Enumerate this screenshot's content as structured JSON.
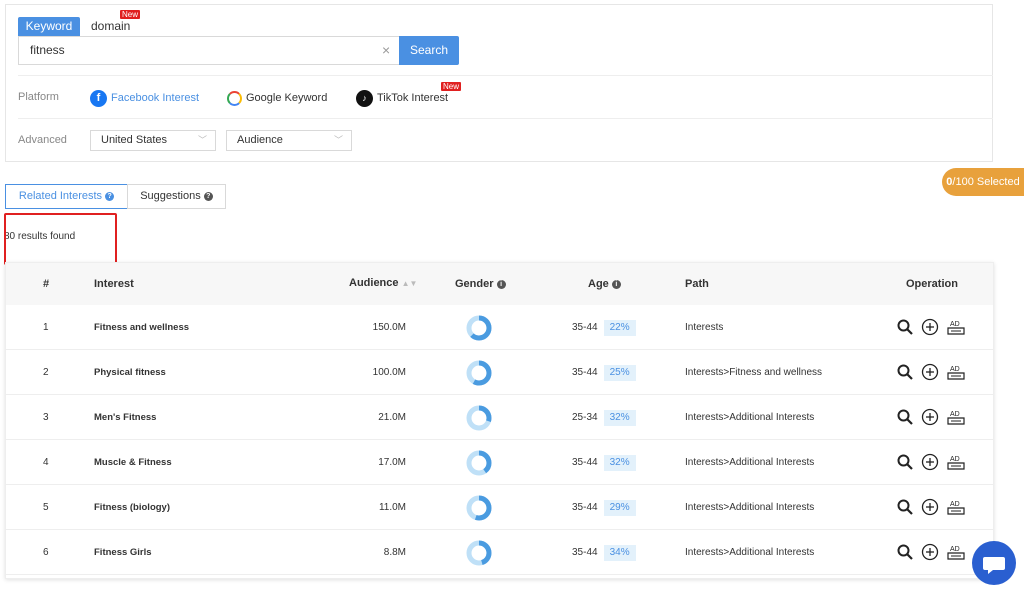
{
  "search": {
    "tab_keyword": "Keyword",
    "tab_domain": "domain",
    "new_label": "New",
    "query": "fitness",
    "search_label": "Search"
  },
  "platform": {
    "label": "Platform",
    "facebook": "Facebook Interest",
    "google": "Google Keyword",
    "tiktok": "TikTok Interest"
  },
  "advanced": {
    "label": "Advanced",
    "country": "United States",
    "audience": "Audience"
  },
  "selected": {
    "count": "0",
    "total": "/100 Selected"
  },
  "result_tabs": {
    "related": "Related Interests",
    "suggestions": "Suggestions"
  },
  "results_count": "80 results found",
  "table": {
    "headers": {
      "index": "#",
      "interest": "Interest",
      "audience": "Audience",
      "gender": "Gender",
      "age": "Age",
      "path": "Path",
      "operation": "Operation"
    },
    "rows": [
      {
        "index": "1",
        "interest": "Fitness and wellness",
        "audience": "150.0M",
        "age": "35-44",
        "pct": "22%",
        "path": "Interests",
        "female_share": 0.62
      },
      {
        "index": "2",
        "interest": "Physical fitness",
        "audience": "100.0M",
        "age": "35-44",
        "pct": "25%",
        "path": "Interests>Fitness and wellness",
        "female_share": 0.58
      },
      {
        "index": "3",
        "interest": "Men's Fitness",
        "audience": "21.0M",
        "age": "25-34",
        "pct": "32%",
        "path": "Interests>Additional Interests",
        "female_share": 0.3
      },
      {
        "index": "4",
        "interest": "Muscle & Fitness",
        "audience": "17.0M",
        "age": "35-44",
        "pct": "32%",
        "path": "Interests>Additional Interests",
        "female_share": 0.4
      },
      {
        "index": "5",
        "interest": "Fitness (biology)",
        "audience": "11.0M",
        "age": "35-44",
        "pct": "29%",
        "path": "Interests>Additional Interests",
        "female_share": 0.55
      },
      {
        "index": "6",
        "interest": "Fitness Girls",
        "audience": "8.8M",
        "age": "35-44",
        "pct": "34%",
        "path": "Interests>Additional Interests",
        "female_share": 0.45
      }
    ]
  },
  "colors": {
    "accent": "#4a90e2",
    "selected_pill": "#e8a13c",
    "badge": "#e02020",
    "donut_dark": "#4a9be0",
    "donut_light": "#bfe0f7"
  }
}
